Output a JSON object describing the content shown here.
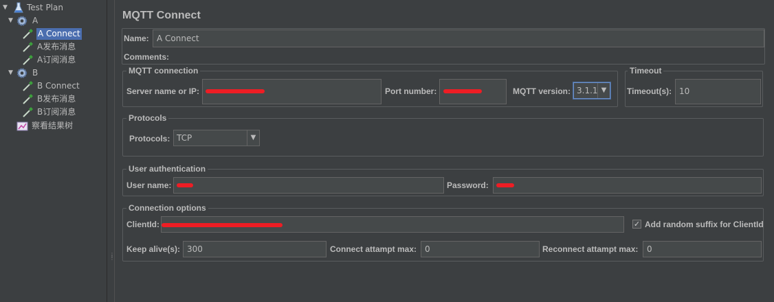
{
  "tree": {
    "items": [
      {
        "label": "Test Plan"
      },
      {
        "label": "A"
      },
      {
        "label": "A Connect"
      },
      {
        "label": "A发布消息"
      },
      {
        "label": "A订阅消息"
      },
      {
        "label": "B"
      },
      {
        "label": "B Connect"
      },
      {
        "label": "B发布消息"
      },
      {
        "label": "B订阅消息"
      },
      {
        "label": "察看结果树"
      }
    ]
  },
  "panel": {
    "title": "MQTT Connect",
    "name_label": "Name:",
    "name_value": "A Connect",
    "comments_label": "Comments:",
    "connection": {
      "legend": "MQTT connection",
      "server_label": "Server name or IP:",
      "port_label": "Port number:",
      "version_label": "MQTT version:",
      "version_value": "3.1.1"
    },
    "timeout": {
      "legend": "Timeout",
      "label": "Timeout(s):",
      "value": "10"
    },
    "protocols": {
      "legend": "Protocols",
      "label": "Protocols:",
      "value": "TCP"
    },
    "auth": {
      "legend": "User authentication",
      "user_label": "User name:",
      "password_label": "Password:"
    },
    "options": {
      "legend": "Connection options",
      "clientid_label": "ClientId:",
      "random_suffix_label": "Add random suffix for ClientId",
      "random_suffix_checked": true,
      "keepalive_label": "Keep alive(s):",
      "keepalive_value": "300",
      "connect_attempt_label": "Connect attampt max:",
      "connect_attempt_value": "0",
      "reconnect_attempt_label": "Reconnect attampt max:",
      "reconnect_attempt_value": "0"
    }
  },
  "colors": {
    "background": "#3c3f41",
    "field": "#45494a",
    "selection": "#4b6eaf",
    "redaction": "#ee1d24"
  }
}
